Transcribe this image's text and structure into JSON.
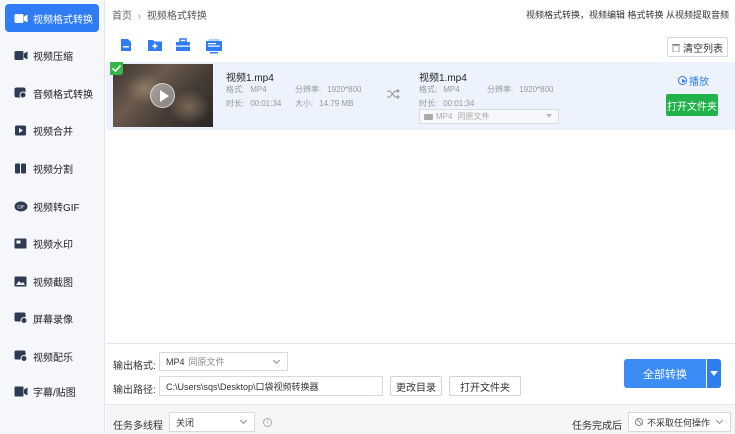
{
  "sidebar": {
    "items": [
      {
        "label": "视频格式转换",
        "icon": "video-convert-icon",
        "active": true
      },
      {
        "label": "视频压缩",
        "icon": "video-compress-icon"
      },
      {
        "label": "音频格式转换",
        "icon": "audio-convert-icon"
      },
      {
        "label": "视频合并",
        "icon": "video-merge-icon"
      },
      {
        "label": "视频分割",
        "icon": "video-split-icon"
      },
      {
        "label": "视频转GIF",
        "icon": "gif-icon"
      },
      {
        "label": "视频水印",
        "icon": "watermark-icon"
      },
      {
        "label": "视频截图",
        "icon": "screenshot-icon"
      },
      {
        "label": "屏幕录像",
        "icon": "screen-record-icon"
      },
      {
        "label": "视频配乐",
        "icon": "music-icon"
      },
      {
        "label": "字幕/贴图",
        "icon": "subtitle-icon"
      }
    ]
  },
  "header": {
    "breadcrumb_home": "首页",
    "breadcrumb_sep": "›",
    "breadcrumb_current": "视频格式转换",
    "top_link": "视频格式转换，视频编辑 格式转换 从视频提取音频"
  },
  "toolbar": {
    "icons": [
      "add-file-icon",
      "add-folder-icon",
      "toolbox-icon",
      "online-video-icon"
    ],
    "online_badge": "online",
    "clear_label": "清空列表"
  },
  "file": {
    "src_name": "视频1.mp4",
    "src_format_label": "格式:",
    "src_format": "MP4",
    "src_res_label": "分辨率:",
    "src_res": "1920*800",
    "src_dur_label": "时长:",
    "src_dur": "00:01:34",
    "src_size_label": "大小:",
    "src_size": "14.79 MB",
    "dst_name": "视频1.mp4",
    "dst_format_label": "格式:",
    "dst_format": "MP4",
    "dst_res_label": "分辨率:",
    "dst_res": "1920*800",
    "dst_dur_label": "时长:",
    "dst_dur": "00:01:34",
    "dst_select_format": "MP4",
    "dst_select_quality": "同原文件",
    "play_label": "播放",
    "open_folder_label": "打开文件夹"
  },
  "output": {
    "format_label": "输出格式:",
    "format_value": "MP4",
    "format_quality": "同原文件",
    "path_label": "输出路径:",
    "path_value": "C:\\Users\\sqs\\Desktop\\口袋视频转换器",
    "change_dir_label": "更改目录",
    "open_folder_label": "打开文件夹",
    "convert_all_label": "全部转换"
  },
  "footer": {
    "multithread_label": "任务多线程",
    "multithread_value": "关闭",
    "info_glyph": "i",
    "after_done_label": "任务完成后",
    "after_done_value": "不采取任何操作"
  },
  "colors": {
    "accent": "#2f7cf6",
    "green": "#21b34a",
    "row_bg": "#ecf3fe"
  }
}
